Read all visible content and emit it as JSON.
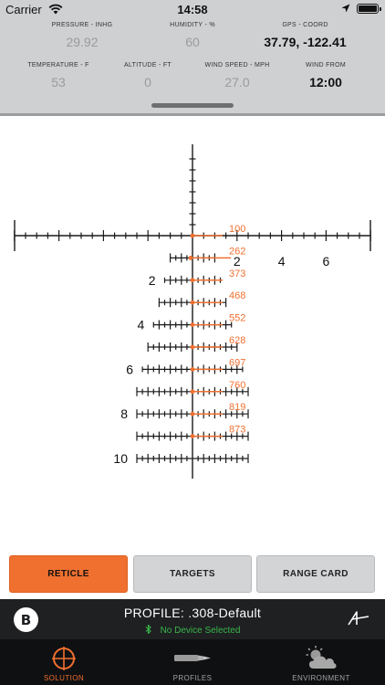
{
  "status_bar": {
    "carrier": "Carrier",
    "time": "14:58"
  },
  "environment": {
    "pressure": {
      "label": "PRESSURE - INHG",
      "value": "29.92"
    },
    "humidity": {
      "label": "HUMIDITY - %",
      "value": "60"
    },
    "gps": {
      "label": "GPS - COORD",
      "value": "37.79, -122.41"
    },
    "temperature": {
      "label": "TEMPERATURE - F",
      "value": "53"
    },
    "altitude": {
      "label": "ALTITUDE - FT",
      "value": "0"
    },
    "wind_speed": {
      "label": "WIND SPEED - MPH",
      "value": "27.0"
    },
    "wind_from": {
      "label": "WIND FROM",
      "value": "12:00"
    }
  },
  "reticle": {
    "accent_color": "#f07030",
    "horizontal_labels": [
      "2",
      "4",
      "6"
    ],
    "left_labels": [
      "2",
      "4",
      "6",
      "8",
      "10"
    ],
    "ranges": [
      "100",
      "262",
      "373",
      "468",
      "552",
      "628",
      "697",
      "760",
      "819",
      "873"
    ]
  },
  "tabs": [
    {
      "label": "RETICLE",
      "active": true
    },
    {
      "label": "TARGETS",
      "active": false
    },
    {
      "label": "RANGE CARD",
      "active": false
    }
  ],
  "profile": {
    "logo_letter": "B",
    "name": "PROFILE: .308-Default",
    "device_status": "No Device Selected",
    "device_icon": "bluetooth-icon",
    "status_color": "#3ab64a"
  },
  "nav": [
    {
      "label": "SOLUTION",
      "icon": "crosshair-icon",
      "active": true
    },
    {
      "label": "PROFILES",
      "icon": "cartridge-icon",
      "active": false
    },
    {
      "label": "ENVIRONMENT",
      "icon": "weather-icon",
      "active": false
    }
  ]
}
